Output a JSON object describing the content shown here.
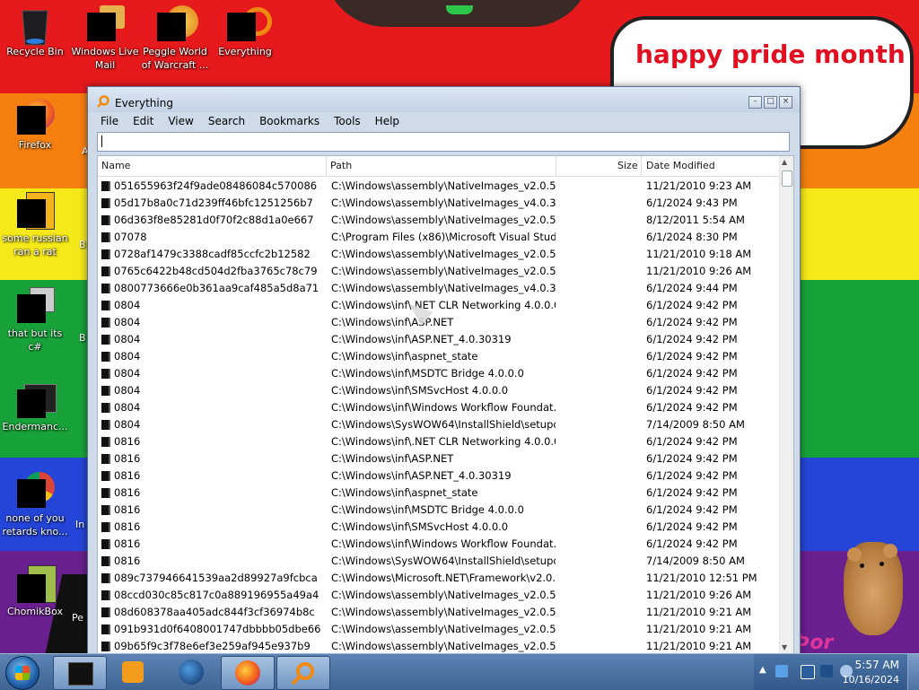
{
  "desktop": {
    "speech_bubble": "happy pride month",
    "corner_text": "Þor",
    "icons": [
      {
        "label": "Recycle Bin"
      },
      {
        "label": "Windows Live Mail"
      },
      {
        "label": "Peggle World of Warcraft ..."
      },
      {
        "label": "Everything"
      },
      {
        "label": "Firefox"
      },
      {
        "label": "some russian ran a rat"
      },
      {
        "label": "that but its c#"
      },
      {
        "label": "Endermanc..."
      },
      {
        "label": "none of you retards kno..."
      },
      {
        "label": "ChomikBox"
      }
    ],
    "partial_labels": [
      "A",
      "B",
      "B",
      "In",
      "Pe"
    ]
  },
  "window": {
    "title": "Everything",
    "menu": [
      "File",
      "Edit",
      "View",
      "Search",
      "Bookmarks",
      "Tools",
      "Help"
    ],
    "search_value": "",
    "columns": {
      "name": "Name",
      "path": "Path",
      "size": "Size",
      "date": "Date Modified"
    },
    "rows": [
      {
        "name": "051655963f24f9ade08486084c570086",
        "path": "C:\\Windows\\assembly\\NativeImages_v2.0.50...",
        "date": "11/21/2010 9:23 AM"
      },
      {
        "name": "05d17b8a0c71d239ff46bfc1251256b7",
        "path": "C:\\Windows\\assembly\\NativeImages_v4.0.30...",
        "date": "6/1/2024 9:43 PM"
      },
      {
        "name": "06d363f8e85281d0f70f2c88d1a0e667",
        "path": "C:\\Windows\\assembly\\NativeImages_v2.0.50...",
        "date": "8/12/2011 5:54 AM"
      },
      {
        "name": "07078",
        "path": "C:\\Program Files (x86)\\Microsoft Visual Studi...",
        "date": "6/1/2024 8:30 PM"
      },
      {
        "name": "0728af1479c3388cadf85ccfc2b12582",
        "path": "C:\\Windows\\assembly\\NativeImages_v2.0.50...",
        "date": "11/21/2010 9:18 AM"
      },
      {
        "name": "0765c6422b48cd504d2fba3765c78c79",
        "path": "C:\\Windows\\assembly\\NativeImages_v2.0.50...",
        "date": "11/21/2010 9:26 AM"
      },
      {
        "name": "0800773666e0b361aa9caf485a5d8a71",
        "path": "C:\\Windows\\assembly\\NativeImages_v4.0.30...",
        "date": "6/1/2024 9:44 PM"
      },
      {
        "name": "0804",
        "path": "C:\\Windows\\inf\\.NET CLR Networking 4.0.0.0",
        "date": "6/1/2024 9:42 PM"
      },
      {
        "name": "0804",
        "path": "C:\\Windows\\inf\\ASP.NET",
        "date": "6/1/2024 9:42 PM"
      },
      {
        "name": "0804",
        "path": "C:\\Windows\\inf\\ASP.NET_4.0.30319",
        "date": "6/1/2024 9:42 PM"
      },
      {
        "name": "0804",
        "path": "C:\\Windows\\inf\\aspnet_state",
        "date": "6/1/2024 9:42 PM"
      },
      {
        "name": "0804",
        "path": "C:\\Windows\\inf\\MSDTC Bridge 4.0.0.0",
        "date": "6/1/2024 9:42 PM"
      },
      {
        "name": "0804",
        "path": "C:\\Windows\\inf\\SMSvcHost 4.0.0.0",
        "date": "6/1/2024 9:42 PM"
      },
      {
        "name": "0804",
        "path": "C:\\Windows\\inf\\Windows Workflow Foundat...",
        "date": "6/1/2024 9:42 PM"
      },
      {
        "name": "0804",
        "path": "C:\\Windows\\SysWOW64\\InstallShield\\setupdir",
        "date": "7/14/2009 8:50 AM"
      },
      {
        "name": "0816",
        "path": "C:\\Windows\\inf\\.NET CLR Networking 4.0.0.0",
        "date": "6/1/2024 9:42 PM"
      },
      {
        "name": "0816",
        "path": "C:\\Windows\\inf\\ASP.NET",
        "date": "6/1/2024 9:42 PM"
      },
      {
        "name": "0816",
        "path": "C:\\Windows\\inf\\ASP.NET_4.0.30319",
        "date": "6/1/2024 9:42 PM"
      },
      {
        "name": "0816",
        "path": "C:\\Windows\\inf\\aspnet_state",
        "date": "6/1/2024 9:42 PM"
      },
      {
        "name": "0816",
        "path": "C:\\Windows\\inf\\MSDTC Bridge 4.0.0.0",
        "date": "6/1/2024 9:42 PM"
      },
      {
        "name": "0816",
        "path": "C:\\Windows\\inf\\SMSvcHost 4.0.0.0",
        "date": "6/1/2024 9:42 PM"
      },
      {
        "name": "0816",
        "path": "C:\\Windows\\inf\\Windows Workflow Foundat...",
        "date": "6/1/2024 9:42 PM"
      },
      {
        "name": "0816",
        "path": "C:\\Windows\\SysWOW64\\InstallShield\\setupdir",
        "date": "7/14/2009 8:50 AM"
      },
      {
        "name": "089c737946641539aa2d89927a9fcbca",
        "path": "C:\\Windows\\Microsoft.NET\\Framework\\v2.0....",
        "date": "11/21/2010 12:51 PM"
      },
      {
        "name": "08ccd030c85c817c0a889196955a49a4",
        "path": "C:\\Windows\\assembly\\NativeImages_v2.0.50...",
        "date": "11/21/2010 9:26 AM"
      },
      {
        "name": "08d608378aa405adc844f3cf36974b8c",
        "path": "C:\\Windows\\assembly\\NativeImages_v2.0.50...",
        "date": "11/21/2010 9:21 AM"
      },
      {
        "name": "091b931d0f6408001747dbbbb05dbe66",
        "path": "C:\\Windows\\assembly\\NativeImages_v2.0.50...",
        "date": "11/21/2010 9:21 AM"
      },
      {
        "name": "09b65f9c3f78e6ef3e259af945e937b9",
        "path": "C:\\Windows\\assembly\\NativeImages_v2.0.50...",
        "date": "11/21/2010 9:21 AM"
      }
    ]
  },
  "taskbar": {
    "apps": [
      "explorer",
      "media-player",
      "browser-globe",
      "firefox",
      "everything"
    ],
    "clock_time": "5:57 AM",
    "clock_date": "10/16/2024"
  },
  "colors": {
    "pride_text": "#e10f1f",
    "window_frame": "#cfdbe9",
    "taskbar": "#4a74a6"
  }
}
